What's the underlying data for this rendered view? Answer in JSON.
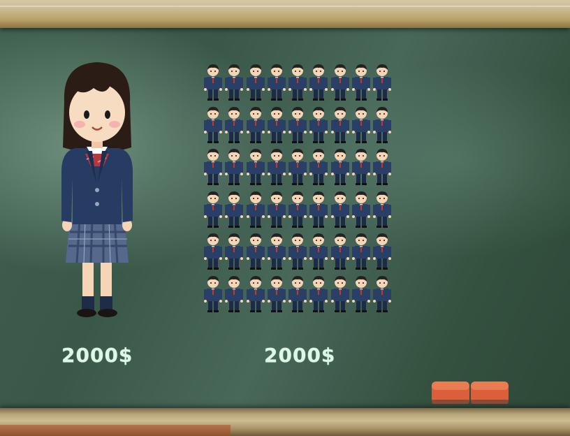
{
  "scene": {
    "left_caption": "2000$",
    "right_caption": "2000$",
    "grid": {
      "rows": 6,
      "columns": 9,
      "figure_count": 54
    }
  },
  "colors": {
    "board": "#3f5f4f",
    "caption_text": "#dff7e6",
    "uniform_navy": "#2a3f66",
    "eraser": "#d9603a"
  },
  "icons": {
    "left_figure": "schoolgirl-illustration",
    "grid_figure": "schoolboy-illustration",
    "erasers": "chalkboard-eraser"
  }
}
